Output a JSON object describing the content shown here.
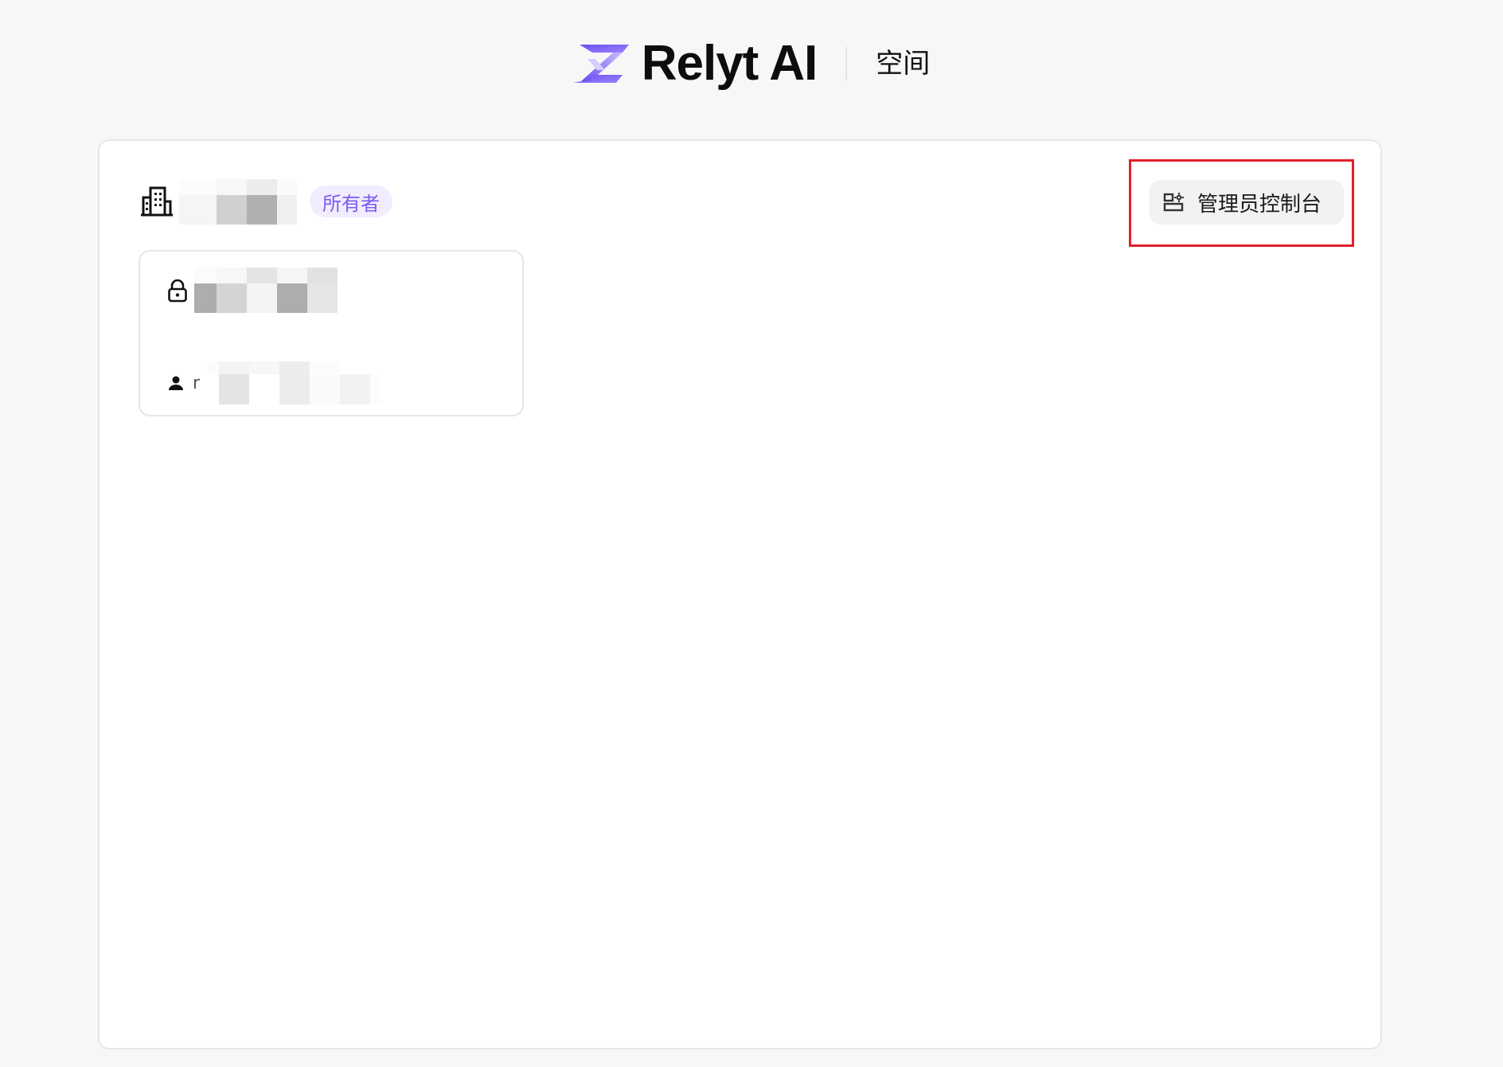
{
  "header": {
    "brand_name": "Relyt AI",
    "section": "空间",
    "brand_color": "#7a5cf0"
  },
  "workspace": {
    "icon": "building-icon",
    "name_redacted": true,
    "role_badge": "所有者"
  },
  "admin": {
    "icon": "admin-console-icon",
    "label": "管理员控制台",
    "highlighted": true,
    "highlight_color": "#e0202a"
  },
  "database_card": {
    "lock_icon": "lock-icon",
    "name_redacted": true,
    "owner_icon": "person-icon",
    "owner_initial": "r",
    "owner_redacted": true
  }
}
